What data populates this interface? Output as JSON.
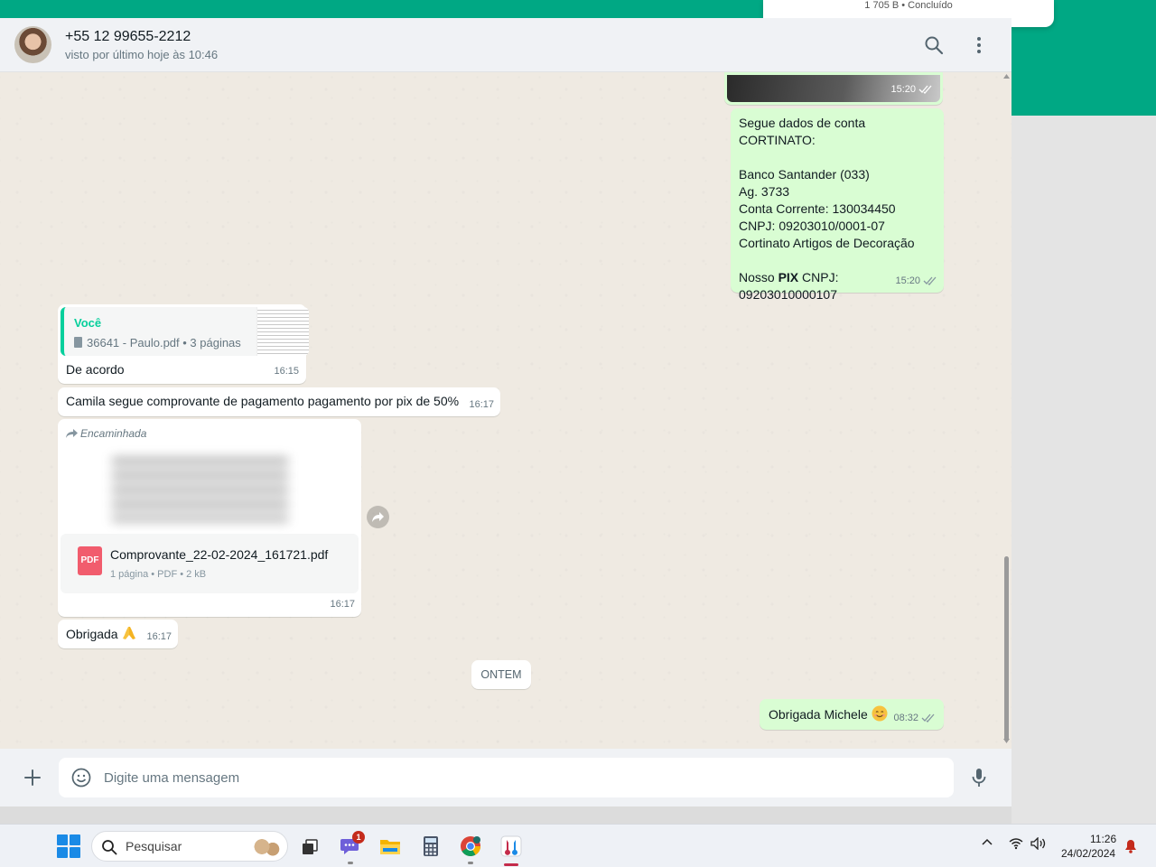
{
  "download": {
    "status": "1 705 B • Concluído"
  },
  "header": {
    "contact_name": "+55 12 99655-2212",
    "status": "visto por último hoje às 10:46",
    "search_icon": "search-icon",
    "menu_icon": "kebab-menu-icon"
  },
  "messages": {
    "image": {
      "time": "15:20"
    },
    "bank": {
      "text": "Segue dados de conta CORTINATO:\n\nBanco Santander (033)\nAg. 3733\nConta Corrente: 130034450\nCNPJ: 09203010/0001-07\nCortinato Artigos de Decoração\n\nNosso ",
      "bold": "PIX",
      "text_after": " CNPJ:\n09203010000107",
      "time": "15:20"
    },
    "reply": {
      "quote_author": "Você",
      "quote_file": "36641 - Paulo.pdf • 3 páginas",
      "text": "De acordo",
      "time": "16:15"
    },
    "camila": {
      "text": "Camila segue comprovante de pagamento pagamento por pix de 50%",
      "time": "16:17"
    },
    "forwarded": {
      "label": "Encaminhada",
      "file_type": "PDF",
      "file_name": "Comprovante_22-02-2024_161721.pdf",
      "file_info": "1 página • PDF • 2 kB",
      "time": "16:17"
    },
    "obrigada": {
      "text": "Obrigada",
      "time": "16:17"
    },
    "date_divider": "ONTEM",
    "michele": {
      "text": "Obrigada Michele",
      "time": "08:32"
    }
  },
  "composer": {
    "placeholder": "Digite uma mensagem"
  },
  "taskbar": {
    "search_label": "Pesquisar",
    "chat_badge": "1",
    "time": "11:26",
    "date": "24/02/2024"
  },
  "colors": {
    "accent": "#00a884",
    "outgoing_bubble": "#d9fdd3",
    "incoming_bubble": "#ffffff",
    "chat_background": "#efeae2",
    "quote_author": "#06cf9c",
    "pdf_icon": "#f15c6d"
  }
}
